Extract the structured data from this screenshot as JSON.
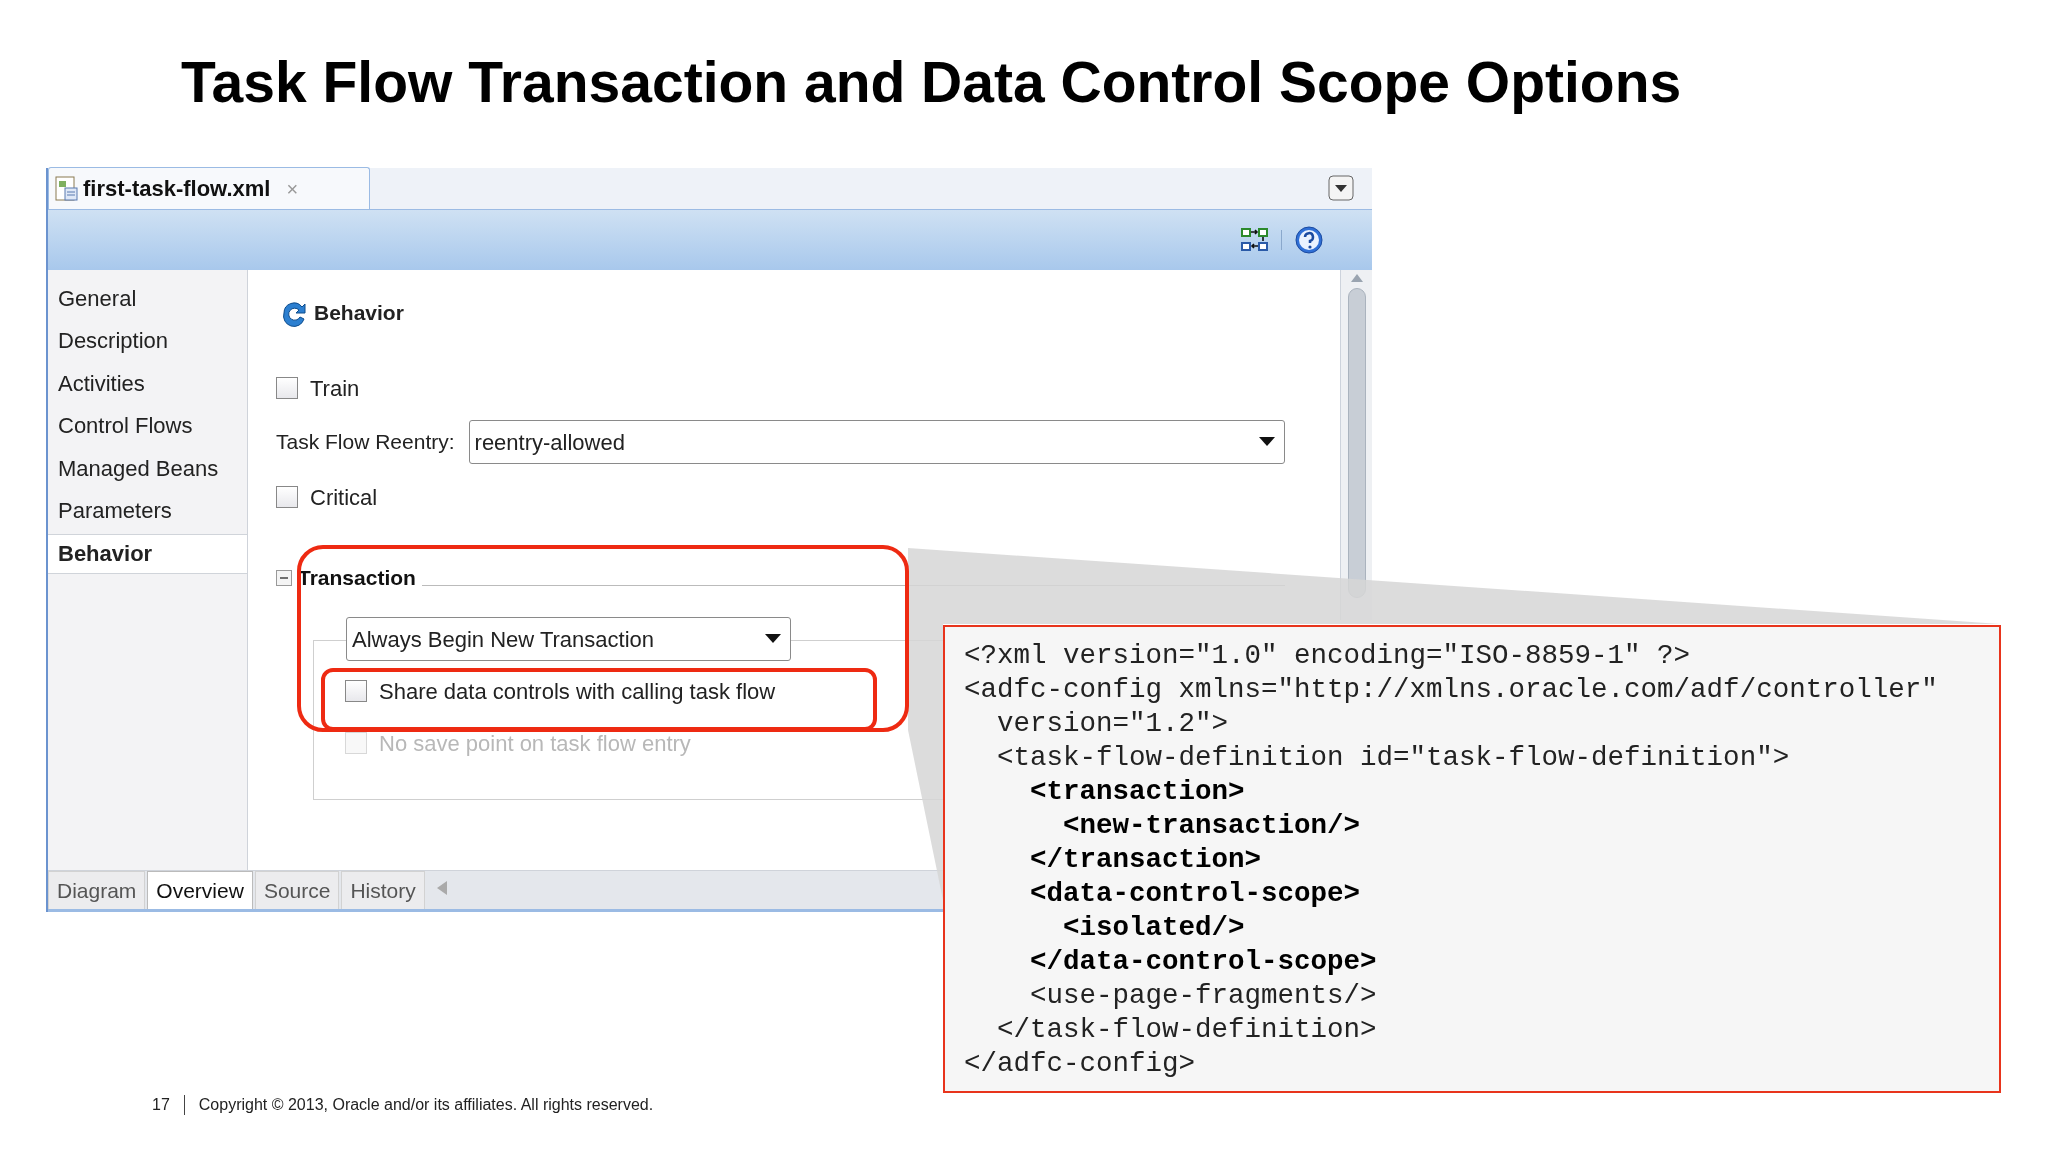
{
  "slide": {
    "title": "Task Flow Transaction and Data Control Scope Options",
    "footer": {
      "page_number": "17",
      "copyright": "Copyright © 2013, Oracle and/or its affiliates. All rights reserved."
    }
  },
  "editor": {
    "file_tab": {
      "label": "first-task-flow.xml",
      "close": "×"
    },
    "sidebar": [
      {
        "label": "General",
        "selected": false
      },
      {
        "label": "Description",
        "selected": false
      },
      {
        "label": "Activities",
        "selected": false
      },
      {
        "label": "Control Flows",
        "selected": false
      },
      {
        "label": "Managed Beans",
        "selected": false
      },
      {
        "label": "Parameters",
        "selected": false
      },
      {
        "label": "Behavior",
        "selected": true
      }
    ],
    "section_title": "Behavior",
    "train": {
      "label": "Train",
      "checked": false
    },
    "reentry": {
      "label": "Task Flow Reentry:",
      "value": "reentry-allowed"
    },
    "critical": {
      "label": "Critical",
      "checked": false
    },
    "transaction": {
      "title": "Transaction",
      "expanded": true,
      "mode": "Always Begin New Transaction",
      "options": [
        {
          "label": "Share data controls with calling task flow",
          "checked": false,
          "disabled": false
        },
        {
          "label": "No save point on task flow entry",
          "checked": false,
          "disabled": true
        }
      ]
    },
    "bottom_tabs": [
      {
        "label": "Diagram",
        "selected": false
      },
      {
        "label": "Overview",
        "selected": true
      },
      {
        "label": "Source",
        "selected": false
      },
      {
        "label": "History",
        "selected": false
      }
    ]
  },
  "code_callout": {
    "lines": [
      {
        "text": "<?xml version=\"1.0\" encoding=\"ISO-8859-1\" ?>",
        "bold": false
      },
      {
        "text": "<adfc-config xmlns=\"http://xmlns.oracle.com/adf/controller\"",
        "bold": false
      },
      {
        "text": "  version=\"1.2\">",
        "bold": false
      },
      {
        "text": "  <task-flow-definition id=\"task-flow-definition\">",
        "bold": false
      },
      {
        "text": "    <transaction>",
        "bold": true
      },
      {
        "text": "      <new-transaction/>",
        "bold": true
      },
      {
        "text": "    </transaction>",
        "bold": true
      },
      {
        "text": "    <data-control-scope>",
        "bold": true
      },
      {
        "text": "      <isolated/>",
        "bold": true
      },
      {
        "text": "    </data-control-scope>",
        "bold": true
      },
      {
        "text": "    <use-page-fragments/>",
        "bold": false
      },
      {
        "text": "  </task-flow-definition>",
        "bold": false
      },
      {
        "text": "</adfc-config>",
        "bold": false
      }
    ]
  }
}
